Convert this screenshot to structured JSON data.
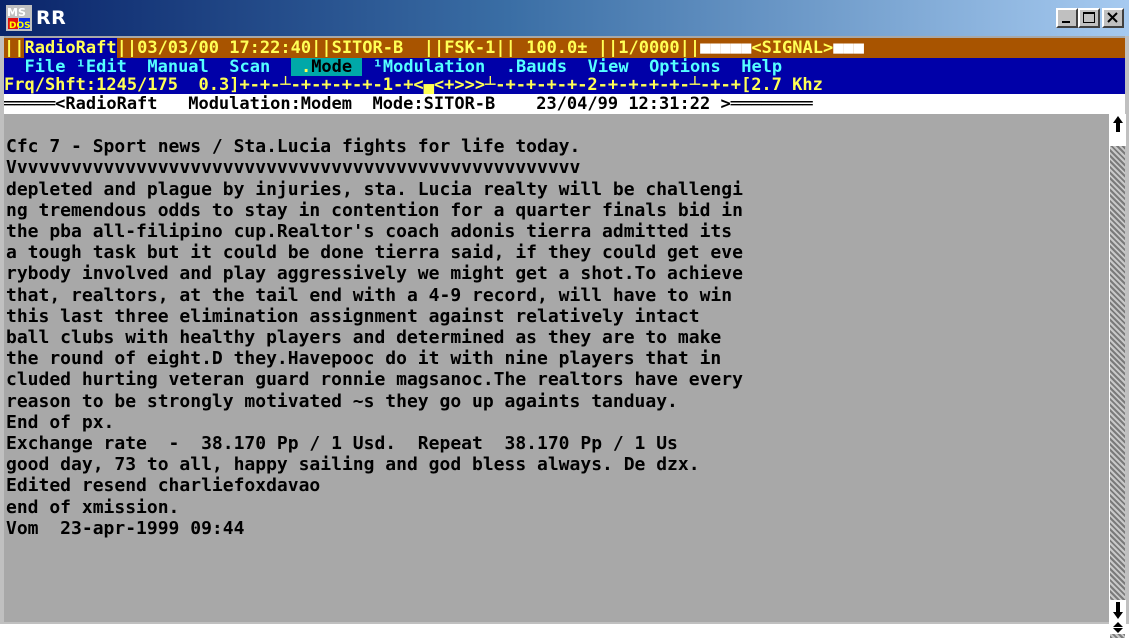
{
  "window": {
    "title": "RR",
    "icon": "ms-dos-icon",
    "controls": [
      "minimize-icon",
      "maximize-icon",
      "close-icon"
    ]
  },
  "status_bar": {
    "app": "RadioRaft",
    "datetime": "03/03/00 17:22:40",
    "mode": "SITOR-B",
    "fsk": "FSK-1",
    "value": "100.0±",
    "counter": "1/0000",
    "signal": "SIGNAL"
  },
  "menu": {
    "items": [
      "File",
      "Edit",
      "Manual",
      "Scan",
      "Mode",
      "Modulation",
      "Bauds",
      "View",
      "Options",
      "Help"
    ],
    "selected": "Mode"
  },
  "freq_line": {
    "label": "Frq/Shft:1245/175",
    "offset": "0.3",
    "scale": "]+-+-┴-+-+-+-+-1-+<▄<+>>>┴-+-+-+-+-2-+-+-+-+-┴-+-+[",
    "bandwidth": "2.7 Khz"
  },
  "separator_line": {
    "text": "═════<RadioRaft   Modulation:Modem  Mode:SITOR-B    23/04/99 12:31:22 >════════"
  },
  "text_lines": [
    "",
    "Cfc 7 - Sport news / Sta.Lucia fights for life today.",
    "Vvvvvvvvvvvvvvvvvvvvvvvvvvvvvvvvvvvvvvvvvvvvvvvvvvvvv",
    "depleted and plague by injuries, sta. Lucia realty will be challengi",
    "ng tremendous odds to stay in contention for a quarter finals bid in",
    "the pba all-filipino cup.Realtor's coach adonis tierra admitted its",
    "a tough task but it could be done tierra said, if they could get eve",
    "rybody involved and play aggressively we might get a shot.To achieve",
    "that, realtors, at the tail end with a 4-9 record, will have to win",
    "this last three elimination assignment against relatively intact",
    "ball clubs with healthy players and determined as they are to make",
    "the round of eight.D they.Havepooc do it with nine players that in",
    "cluded hurting veteran guard ronnie magsanoc.The realtors have every",
    "reason to be strongly motivated ~s they go up againts tanduay.",
    "End of px.",
    "Exchange rate  -  38.170 Pp / 1 Usd.  Repeat  38.170 Pp / 1 Us",
    "good day, 73 to all, happy sailing and god bless always. De dzx.",
    "Edited resend charliefoxdavao",
    "end of xmission.",
    "Vom  23-apr-1999 09:44"
  ]
}
